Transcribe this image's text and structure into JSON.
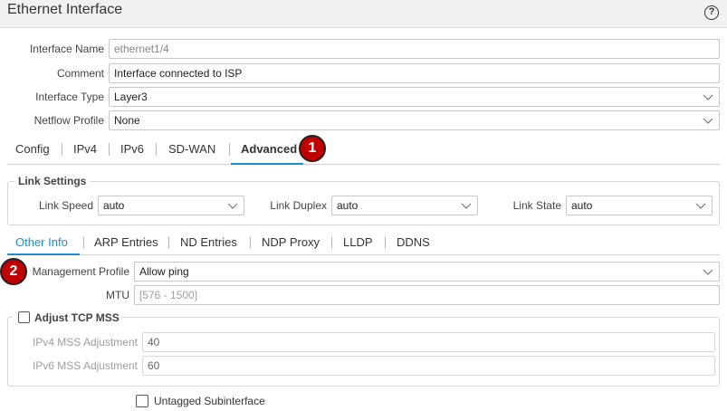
{
  "header": {
    "title": "Ethernet Interface",
    "help_icon": "?"
  },
  "general": {
    "interface_name": {
      "label": "Interface Name",
      "value": "ethernet1/4"
    },
    "comment": {
      "label": "Comment",
      "value": "Interface connected to ISP"
    },
    "interface_type": {
      "label": "Interface Type",
      "value": "Layer3"
    },
    "netflow_profile": {
      "label": "Netflow Profile",
      "value": "None"
    }
  },
  "main_tabs": [
    {
      "label": "Config"
    },
    {
      "label": "IPv4"
    },
    {
      "label": "IPv6"
    },
    {
      "label": "SD-WAN"
    },
    {
      "label": "Advanced",
      "active": true
    }
  ],
  "callouts": {
    "one": "1",
    "two": "2"
  },
  "link_settings": {
    "legend": "Link Settings",
    "speed": {
      "label": "Link Speed",
      "value": "auto"
    },
    "duplex": {
      "label": "Link Duplex",
      "value": "auto"
    },
    "state": {
      "label": "Link State",
      "value": "auto"
    }
  },
  "sub_tabs": [
    {
      "label": "Other Info",
      "active": true
    },
    {
      "label": "ARP Entries"
    },
    {
      "label": "ND Entries"
    },
    {
      "label": "NDP Proxy"
    },
    {
      "label": "LLDP"
    },
    {
      "label": "DDNS"
    }
  ],
  "other_info": {
    "management_profile": {
      "label": "Management Profile",
      "value": "Allow ping"
    },
    "mtu": {
      "label": "MTU",
      "placeholder": "[576 - 1500]"
    },
    "adjust_tcp_mss": {
      "label": "Adjust TCP MSS",
      "checked": false
    },
    "ipv4_mss": {
      "label": "IPv4 MSS Adjustment",
      "value": "40"
    },
    "ipv6_mss": {
      "label": "IPv6 MSS Adjustment",
      "value": "60"
    },
    "untagged_subinterface": {
      "label": "Untagged Subinterface",
      "checked": false
    }
  },
  "colors": {
    "accent": "#1a8fd1",
    "callout": "#c00000"
  }
}
